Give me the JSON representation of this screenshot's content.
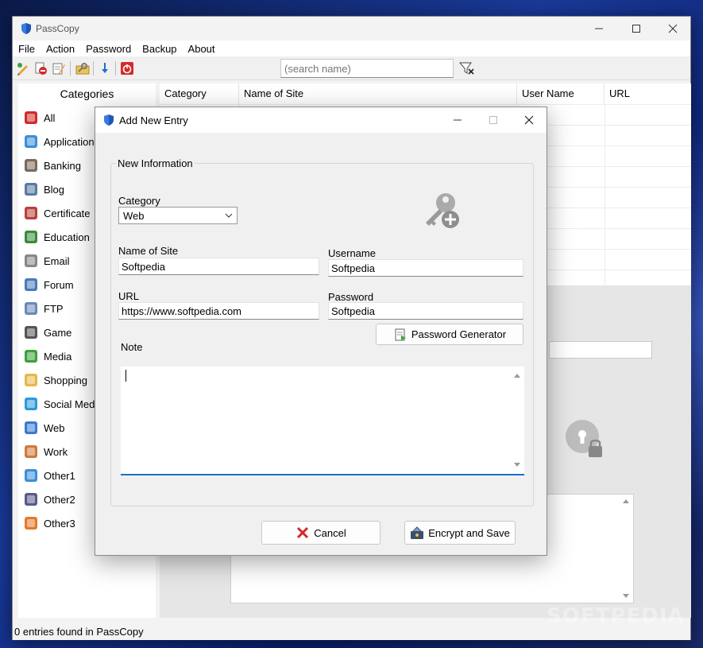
{
  "app": {
    "title": "PassCopy"
  },
  "menu": [
    "File",
    "Action",
    "Password",
    "Backup",
    "About"
  ],
  "toolbar": {
    "search_placeholder": "(search name)",
    "icons": [
      "add-entry-icon",
      "delete-entry-icon",
      "edit-entry-icon",
      "key-folder-icon",
      "download-icon",
      "power-icon"
    ]
  },
  "categories": {
    "header": "Categories",
    "items": [
      {
        "label": "All",
        "icon": "all-icon"
      },
      {
        "label": "Application",
        "icon": "application-icon"
      },
      {
        "label": "Banking",
        "icon": "banking-icon"
      },
      {
        "label": "Blog",
        "icon": "blog-icon"
      },
      {
        "label": "Certificate",
        "icon": "certificate-icon"
      },
      {
        "label": "Education",
        "icon": "education-icon"
      },
      {
        "label": "Email",
        "icon": "email-icon"
      },
      {
        "label": "Forum",
        "icon": "forum-icon"
      },
      {
        "label": "FTP",
        "icon": "ftp-icon"
      },
      {
        "label": "Game",
        "icon": "game-icon"
      },
      {
        "label": "Media",
        "icon": "media-icon"
      },
      {
        "label": "Shopping",
        "icon": "shopping-icon"
      },
      {
        "label": "Social Media",
        "icon": "social-media-icon"
      },
      {
        "label": "Web",
        "icon": "web-icon"
      },
      {
        "label": "Work",
        "icon": "work-icon"
      },
      {
        "label": "Other1",
        "icon": "other1-icon"
      },
      {
        "label": "Other2",
        "icon": "other2-icon"
      },
      {
        "label": "Other3",
        "icon": "other3-icon"
      }
    ]
  },
  "grid": {
    "columns": [
      "Category",
      "Name of Site",
      "User Name",
      "URL"
    ]
  },
  "status": {
    "text": "0 entries found in PassCopy"
  },
  "dialog": {
    "title": "Add New Entry",
    "group_title": "New Information",
    "category_label": "Category",
    "category_value": "Web",
    "site_label": "Name of Site",
    "site_value": "Softpedia",
    "username_label": "Username",
    "username_value": "Softpedia",
    "url_label": "URL",
    "url_value": "https://www.softpedia.com",
    "password_label": "Password",
    "password_value": "Softpedia",
    "password_generator_label": "Password Generator",
    "note_label": "Note",
    "note_value": "",
    "cancel_label": "Cancel",
    "save_label": "Encrypt and Save"
  },
  "watermark": "SOFTPEDIA",
  "colors": {
    "accent": "#1a6fc6",
    "danger": "#d12b2b"
  }
}
